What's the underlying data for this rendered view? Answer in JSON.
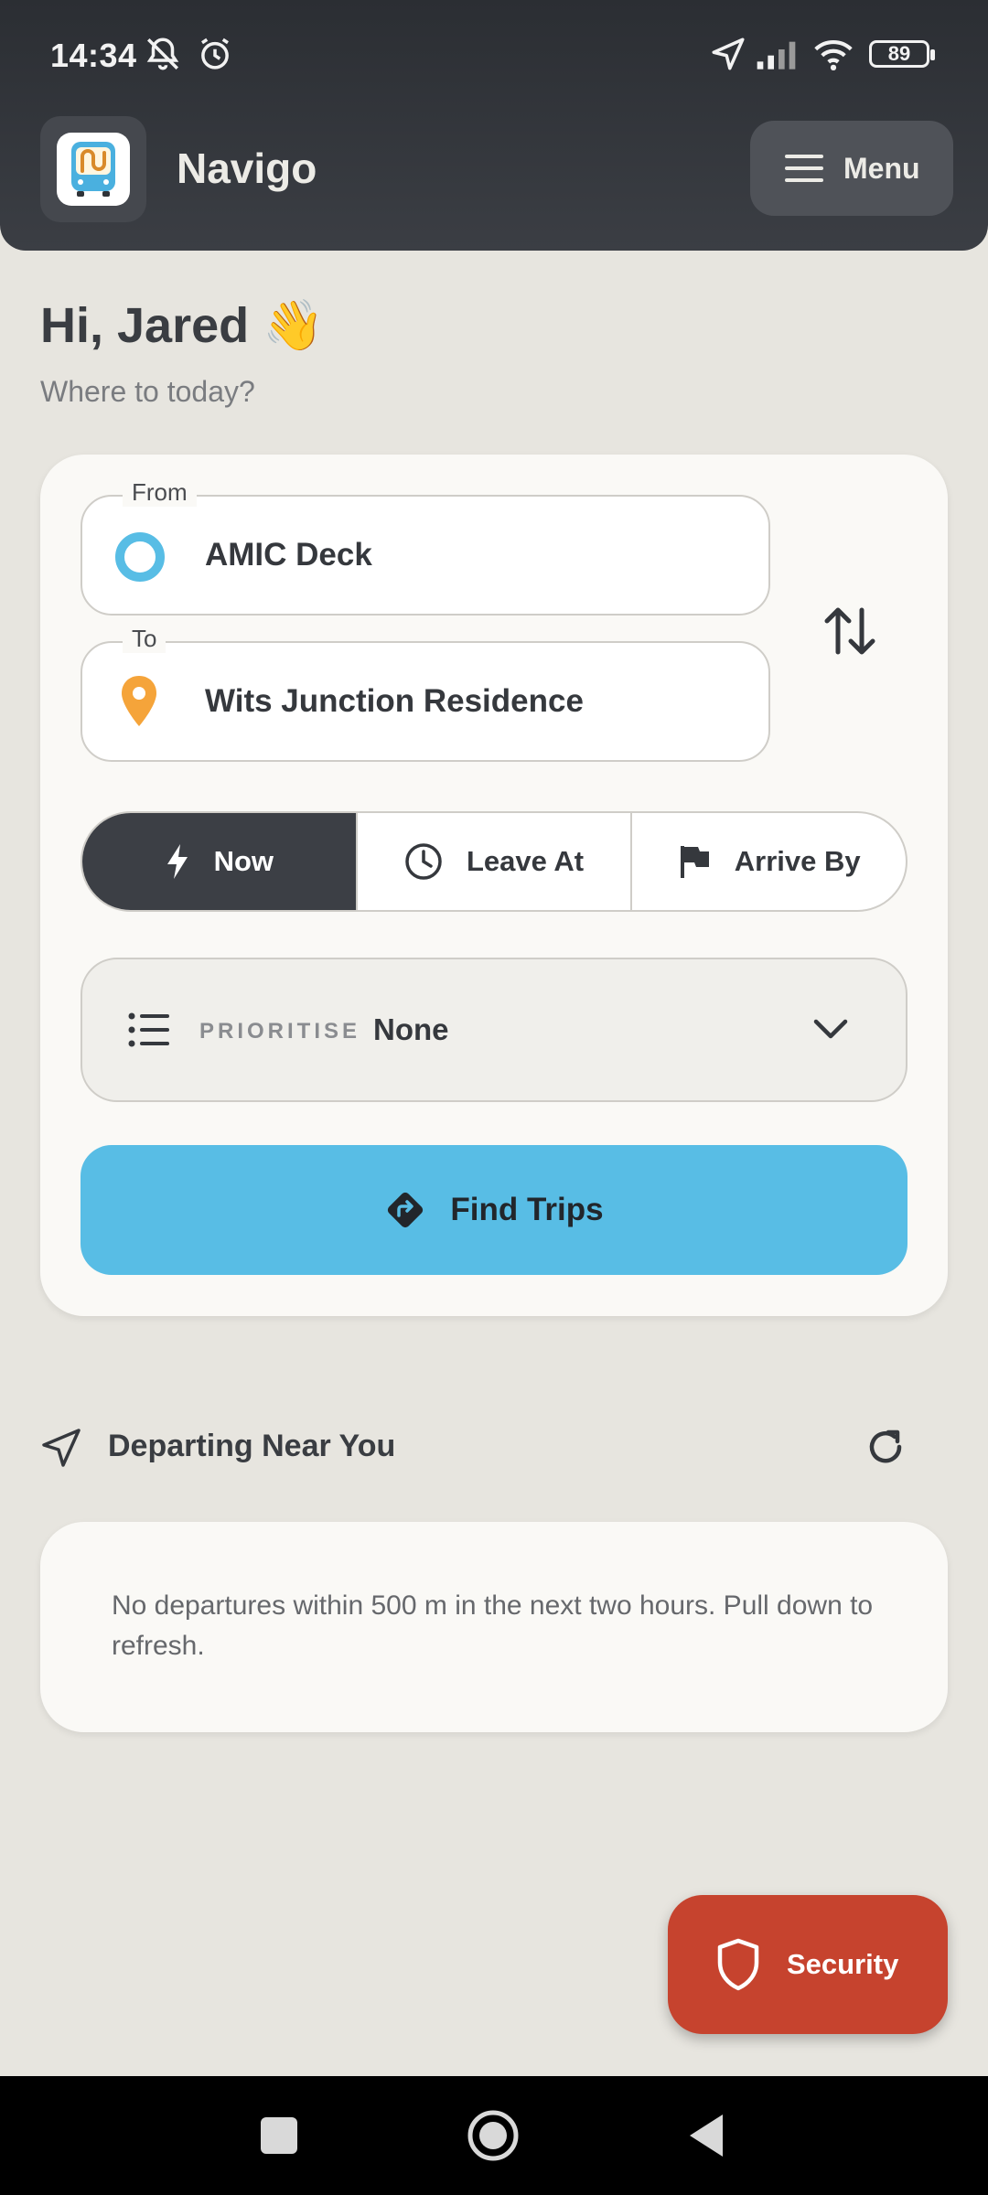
{
  "status_bar": {
    "time": "14:34",
    "battery": "89",
    "icons": [
      "mute-bell-icon",
      "alarm-icon",
      "location-arrow-icon",
      "signal-icon",
      "wifi-icon",
      "battery-icon"
    ]
  },
  "header": {
    "app_title": "Navigo",
    "menu_label": "Menu"
  },
  "greeting": {
    "title": "Hi, Jared",
    "emoji": "👋",
    "subtitle": "Where to today?"
  },
  "trip_form": {
    "from_label": "From",
    "from_value": "AMIC Deck",
    "to_label": "To",
    "to_value": "Wits Junction Residence",
    "time_modes": [
      {
        "label": "Now",
        "icon": "bolt-icon",
        "active": true
      },
      {
        "label": "Leave At",
        "icon": "clock-icon",
        "active": false
      },
      {
        "label": "Arrive By",
        "icon": "flag-icon",
        "active": false
      }
    ],
    "prioritise_label": "PRIORITISE",
    "prioritise_value": "None",
    "find_label": "Find Trips"
  },
  "departures": {
    "title": "Departing Near You",
    "empty_message": "No departures within 500 m in the next two hours. Pull down to refresh."
  },
  "security_label": "Security",
  "colors": {
    "accent": "#58bde5",
    "dark": "#3c3f45",
    "security": "#c6432e",
    "pin": "#f5a43a",
    "origin": "#58bde5"
  }
}
